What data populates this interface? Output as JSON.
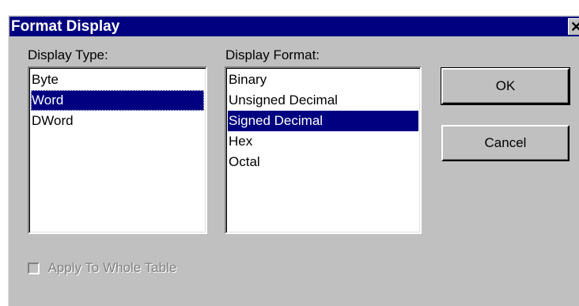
{
  "dialog": {
    "title": "Format Display",
    "close_glyph": "✕"
  },
  "display_type": {
    "label": "Display Type:",
    "items": [
      {
        "label": "Byte",
        "selected": false
      },
      {
        "label": "Word",
        "selected": true
      },
      {
        "label": "DWord",
        "selected": false
      }
    ]
  },
  "display_format": {
    "label": "Display Format:",
    "items": [
      {
        "label": "Binary",
        "selected": false
      },
      {
        "label": "Unsigned Decimal",
        "selected": false
      },
      {
        "label": "Signed Decimal",
        "selected": true
      },
      {
        "label": "Hex",
        "selected": false
      },
      {
        "label": "Octal",
        "selected": false
      }
    ]
  },
  "buttons": {
    "ok": "OK",
    "cancel": "Cancel"
  },
  "apply_whole_table": {
    "label": "Apply To Whole Table",
    "checked": false,
    "enabled": false
  },
  "colors": {
    "titlebar": "#000080",
    "selection": "#000080",
    "face": "#c0c0c0",
    "disabled_text": "#808080"
  }
}
